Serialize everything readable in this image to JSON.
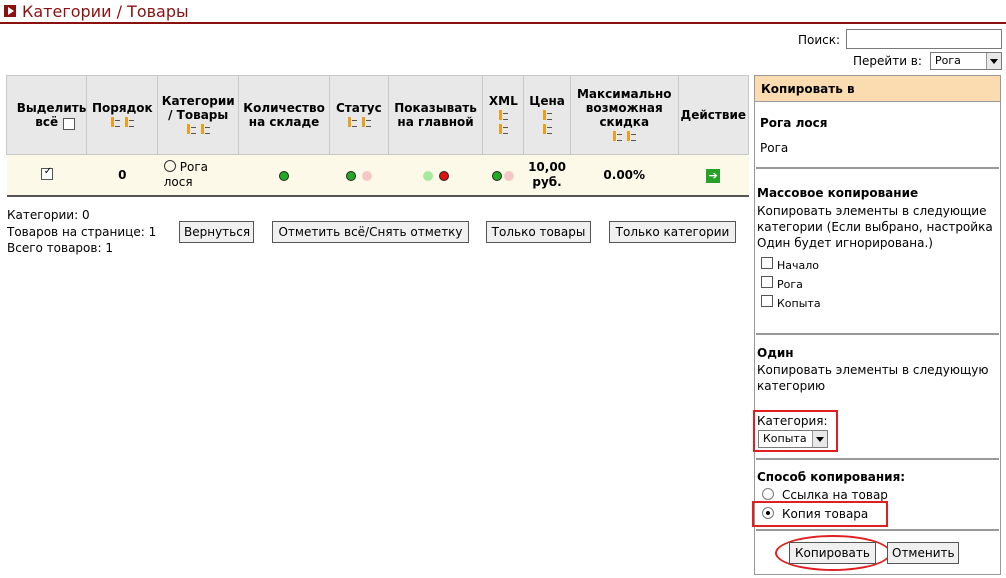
{
  "page": {
    "title": "Категории / Товары"
  },
  "search": {
    "label": "Поиск:",
    "value": ""
  },
  "goto": {
    "label": "Перейти в:",
    "selected": "Рога"
  },
  "table": {
    "headers": {
      "select_all": "Выделить всё",
      "order": "Порядок",
      "categories": "Категории / Товары",
      "stock": "Количество на складе",
      "status": "Статус",
      "show_main": "Показывать на главной",
      "xml": "XML",
      "price": "Цена",
      "max_discount": "Максимально возможная скидка",
      "action": "Действие"
    },
    "row": {
      "order": "0",
      "name": "Рога лося",
      "price": "10,00 руб.",
      "discount": "0.00%"
    }
  },
  "colors": {
    "green": "#22aa22",
    "pink": "#f4c8c8",
    "light_green": "#a8e8a0",
    "red": "#dd1111",
    "brand": "#8b1010",
    "panel_head": "#fbdcb0"
  },
  "stats": {
    "categories": "Категории: 0",
    "per_page": "Товаров на странице: 1",
    "total": "Всего товаров: 1"
  },
  "buttons": {
    "back": "Вернуться",
    "toggle_all": "Отметить всё/Снять отметку",
    "only_products": "Только товары",
    "only_categories": "Только категории"
  },
  "side": {
    "heading": "Копировать в",
    "product_title": "Рога лося",
    "product_name": "Рога",
    "mass_title": "Массовое копирование",
    "mass_desc": "Копировать элементы в следующие категории (Если выбрано, настройка Один будет игнорирована.)",
    "mass_options": [
      "Начало",
      "Рога",
      "Копыта"
    ],
    "single_title": "Один",
    "single_desc": "Копировать элементы в следующую категорию",
    "category_label": "Категория:",
    "category_selected": "Копыта",
    "method_title": "Способ копирования:",
    "method_link": "Ссылка на товар",
    "method_copy": "Копия товара",
    "copy_button": "Копировать",
    "cancel_button": "Отменить"
  }
}
